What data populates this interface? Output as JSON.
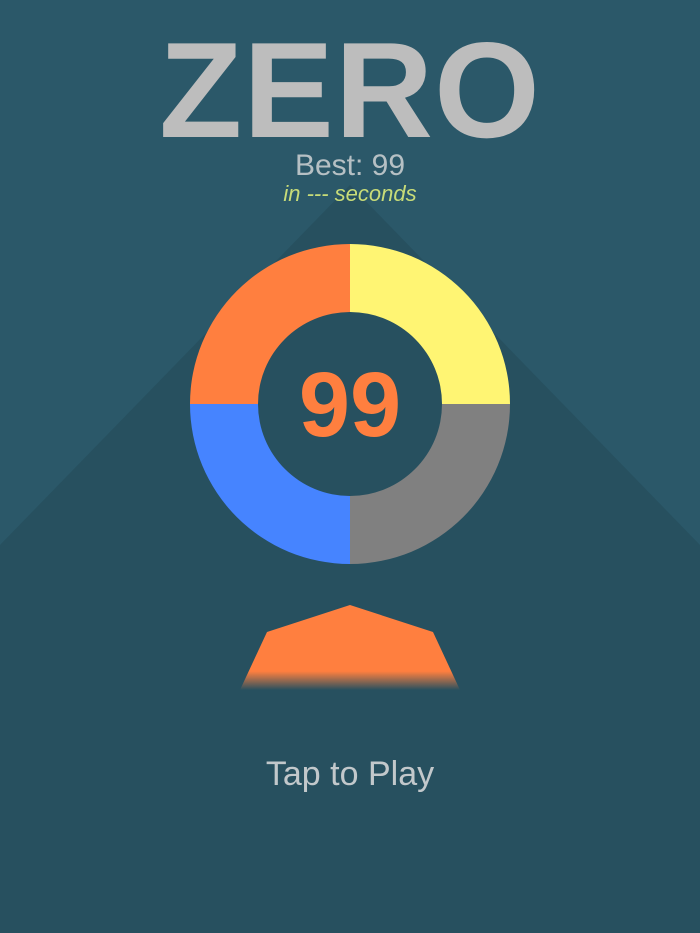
{
  "game": {
    "title": "ZERO",
    "best_label": "Best: 99",
    "best_time_label": "in --- seconds",
    "score": "99",
    "tap_prompt": "Tap to Play"
  },
  "colors": {
    "background": "#2b5869",
    "background_shade": "#27505f",
    "segment_top_left": "#ff7f3f",
    "segment_top_right": "#fff573",
    "segment_bottom_right": "#808080",
    "segment_bottom_left": "#4684ff",
    "player": "#ff7f3f",
    "title": "#bdbdbd",
    "best_time": "#c8dc78"
  },
  "icons": {
    "ring": "four-segment-color-wheel",
    "player": "hexagon-shape"
  }
}
